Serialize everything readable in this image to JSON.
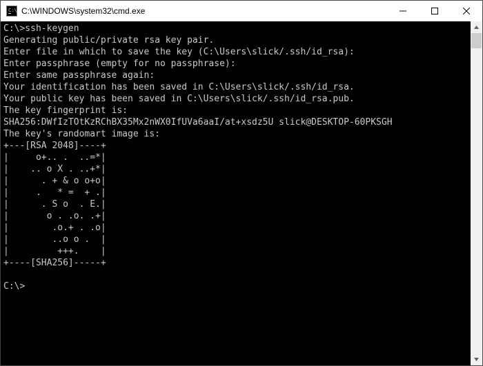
{
  "window": {
    "title": "C:\\WINDOWS\\system32\\cmd.exe"
  },
  "console": {
    "lines": [
      "C:\\>ssh-keygen",
      "Generating public/private rsa key pair.",
      "Enter file in which to save the key (C:\\Users\\slick/.ssh/id_rsa):",
      "Enter passphrase (empty for no passphrase):",
      "Enter same passphrase again:",
      "Your identification has been saved in C:\\Users\\slick/.ssh/id_rsa.",
      "Your public key has been saved in C:\\Users\\slick/.ssh/id_rsa.pub.",
      "The key fingerprint is:",
      "SHA256:DWfIzTOtKzRChBX35Mx2nWX0IfUVa6aaI/at+xsdz5U slick@DESKTOP-60PKSGH",
      "The key's randomart image is:",
      "+---[RSA 2048]----+",
      "|     o+.. .  ..=*|",
      "|    .. o X . ..+*|",
      "|      . + & o o+o|",
      "|     .   * =  + .|",
      "|      . S o  . E.|",
      "|       o . .o. .+|",
      "|        .o.+ . .o|",
      "|        ..o o .  |",
      "|         +++.    |",
      "+----[SHA256]-----+",
      "",
      "C:\\>"
    ]
  },
  "icons": {
    "app": "cmd-icon",
    "minimize": "minimize-icon",
    "maximize": "maximize-icon",
    "close": "close-icon",
    "scroll_up": "scroll-up-icon",
    "scroll_down": "scroll-down-icon"
  }
}
